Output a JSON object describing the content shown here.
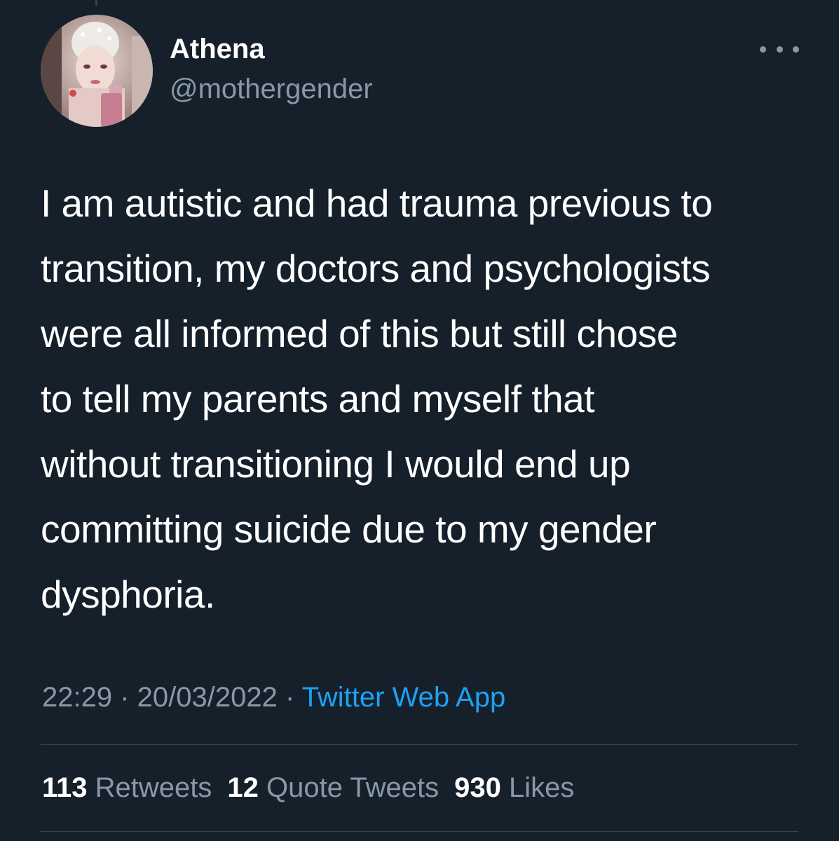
{
  "user": {
    "name": "Athena",
    "handle": "@mothergender"
  },
  "tweet": {
    "lines": [
      "I am autistic and had trauma previous to",
      "transition, my doctors and psychologists",
      "were all informed of this but still chose",
      "to tell my parents and myself that",
      "without transitioning I would end up",
      "committing suicide due to my gender",
      "dysphoria."
    ],
    "time": "22:29",
    "separator": " · ",
    "date": "20/03/2022",
    "source": "Twitter Web App"
  },
  "stats": {
    "retweets_count": "113",
    "retweets_label": "Retweets",
    "quotes_count": "12",
    "quotes_label": "Quote Tweets",
    "likes_count": "930",
    "likes_label": "Likes"
  },
  "icons": {
    "more": "more-options-icon"
  },
  "colors": {
    "background": "#15202b",
    "text": "#ffffff",
    "secondary": "#8899a6",
    "link": "#1da1f2",
    "divider": "#38444d"
  }
}
